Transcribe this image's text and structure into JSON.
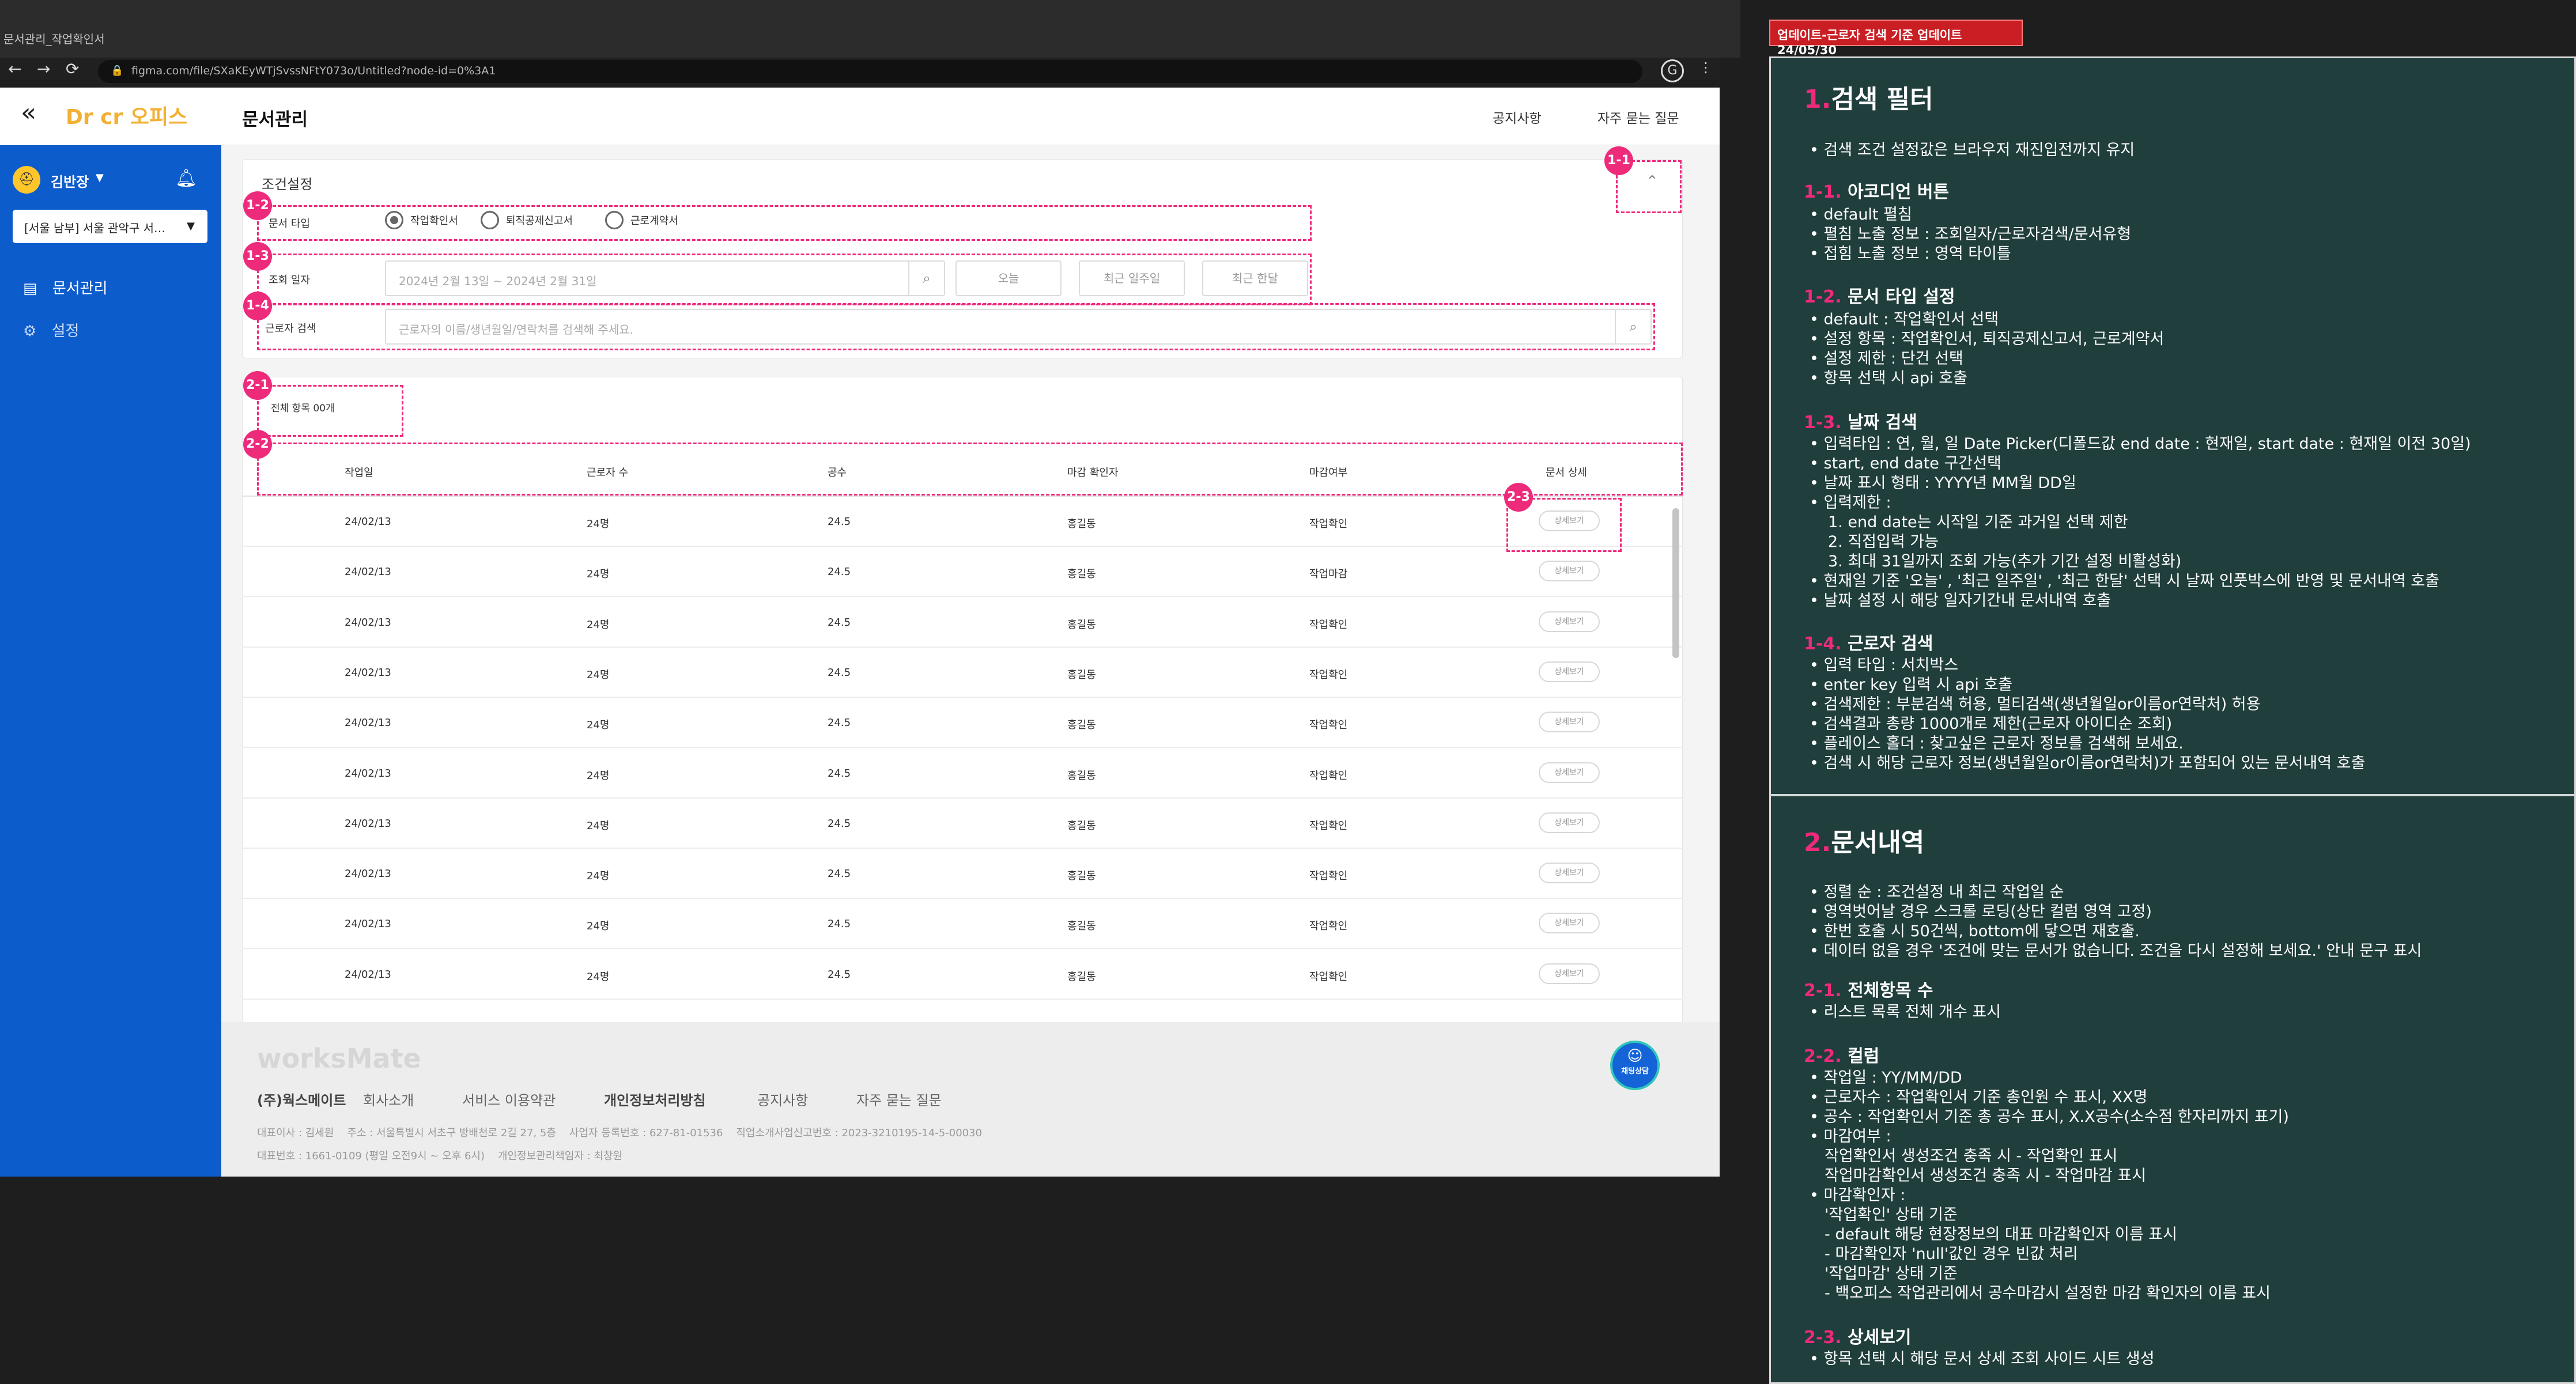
{
  "browser": {
    "tab_title": "문서관리_작업확인서",
    "url": "figma.com/file/SXaKEyWTjSvssNFtY073o/Untitled?node-id=0%3A1"
  },
  "app": {
    "logo": "Dr cr 오피스",
    "page_title": "문서관리",
    "header_links": [
      "공지사항",
      "자주 묻는 질문"
    ],
    "user": {
      "name": "김반장"
    },
    "site_select": "[서울 남부] 서울 관악구 서…",
    "nav": [
      {
        "label": "문서관리"
      },
      {
        "label": "설정"
      }
    ]
  },
  "filter": {
    "title": "조건설정",
    "doc_type_label": "문서 타입",
    "doc_types": [
      "작업확인서",
      "퇴직공제신고서",
      "근로계약서"
    ],
    "date_label": "조회 일자",
    "date_value": "2024년 2월 13일 ~ 2024년 2월 31일",
    "quick_buttons": [
      "오늘",
      "최근 일주일",
      "최근 한달"
    ],
    "worker_label": "근로자 검색",
    "worker_placeholder": "근로자의 이름/생년월일/연락처를 검색해 주세요."
  },
  "list": {
    "total": "전체 항목 00개",
    "columns": [
      "작업일",
      "근로자 수",
      "공수",
      "마감 확인자",
      "마감여부",
      "문서 상세"
    ],
    "detail_label": "상세보기",
    "rows": [
      [
        "24/02/13",
        "24명",
        "24.5",
        "홍길동",
        "작업확인"
      ],
      [
        "24/02/13",
        "24명",
        "24.5",
        "홍길동",
        "작업마감"
      ],
      [
        "24/02/13",
        "24명",
        "24.5",
        "홍길동",
        "작업확인"
      ],
      [
        "24/02/13",
        "24명",
        "24.5",
        "홍길동",
        "작업확인"
      ],
      [
        "24/02/13",
        "24명",
        "24.5",
        "홍길동",
        "작업확인"
      ],
      [
        "24/02/13",
        "24명",
        "24.5",
        "홍길동",
        "작업확인"
      ],
      [
        "24/02/13",
        "24명",
        "24.5",
        "홍길동",
        "작업확인"
      ],
      [
        "24/02/13",
        "24명",
        "24.5",
        "홍길동",
        "작업확인"
      ],
      [
        "24/02/13",
        "24명",
        "24.5",
        "홍길동",
        "작업확인"
      ],
      [
        "24/02/13",
        "24명",
        "24.5",
        "홍길동",
        "작업확인"
      ]
    ]
  },
  "footer": {
    "brand": "worksMate",
    "links": [
      "(주)웍스메이트",
      "회사소개",
      "서비스 이용약관",
      "개인정보처리방침",
      "공지사항",
      "자주 묻는 질문"
    ],
    "info1": "대표이사 : 김세원    주소 : 서울특별시 서초구 방배천로 2길 27, 5층    사업자 등록번호 : 627-81-01536    직업소개사업신고번호 : 2023-3210195-14-5-00030",
    "info2": "대표번호 : 1661-0109 (평일 오전9시 ~ 오후 6시)    개인정보관리책임자 : 최창원",
    "chat": "채팅상담"
  },
  "tags": [
    "1-1",
    "1-2",
    "1-3",
    "1-4",
    "2-1",
    "2-2",
    "2-3"
  ],
  "panel": {
    "update": "업데이트-근로자 검색 기준 업데이트 24/05/30",
    "s1": {
      "num": "1.",
      "title": "검색 필터",
      "note": "검색 조건 설정값은 브라우저 재진입전까지 유지"
    },
    "s11": {
      "num": "1-1.",
      "title": "아코디언 버튼",
      "lines": [
        "default 펼침",
        "펼침 노출 정보 : 조회일자/근로자검색/문서유형",
        "접힘 노출 정보 : 영역 타이틀"
      ]
    },
    "s12": {
      "num": "1-2.",
      "title": "문서 타입 설정",
      "lines": [
        "default : 작업확인서 선택",
        "설정 항목 : 작업확인서, 퇴직공제신고서, 근로계약서",
        "설정 제한 : 단건 선택",
        "항목 선택 시 api 호출"
      ]
    },
    "s13": {
      "num": "1-3.",
      "title": "날짜 검색",
      "lines": [
        "입력타입 : 연, 월, 일 Date Picker(디폴드값 end date : 현재일, start date : 현재일 이전 30일)",
        "start, end date 구간선택",
        "날짜 표시 형태 : YYYY년 MM월 DD일",
        "입력제한 :"
      ],
      "sub": [
        "1. end date는 시작일 기준 과거일 선택 제한",
        "2. 직접입력 가능",
        "3. 최대 31일까지 조회 가능(추가 기간 설정 비활성화)"
      ],
      "lines2": [
        "현재일 기준 '오늘' , '최근 일주일' , '최근 한달' 선택 시 날짜 인풋박스에 반영 및 문서내역 호출",
        "날짜 설정 시 해당 일자기간내 문서내역 호출"
      ]
    },
    "s14": {
      "num": "1-4.",
      "title": "근로자 검색",
      "lines": [
        "입력 타입 : 서치박스",
        "enter key 입력 시 api 호출",
        "검색제한 : 부분검색 허용, 멀티검색(생년월일or이름or연락처) 허용",
        "검색결과 총량 1000개로 제한(근로자 아이디순 조회)",
        "플레이스 홀더 : 찾고싶은 근로자 정보를 검색해 보세요.",
        "검색 시 해당 근로자 정보(생년월일or이름or연락처)가 포함되어 있는 문서내역 호출"
      ]
    },
    "s2": {
      "num": "2.",
      "title": "문서내역",
      "lines": [
        "정렬 순 : 조건설정 내 최근 작업일 순",
        "영역벗어날 경우 스크롤 로딩(상단 컬럼 영역 고정)",
        "한번 호출 시 50건씩, bottom에 닿으면 재호출.",
        "데이터 없을 경우 '조건에 맞는 문서가 없습니다. 조건을 다시 설정해 보세요.' 안내 문구 표시"
      ]
    },
    "s21": {
      "num": "2-1.",
      "title": "전체항목 수",
      "lines": [
        "리스트 목록 전체 개수 표시"
      ]
    },
    "s22": {
      "num": "2-2.",
      "title": "컬럼",
      "lines": [
        "작업일 : YY/MM/DD",
        "근로자수 : 작업확인서 기준 총인원 수 표시, XX명",
        "공수 : 작업확인서 기준 총 공수 표시, X.X공수(소수점 한자리까지 표기)",
        "마감여부 :"
      ],
      "sub1": [
        "작업확인서 생성조건 충족 시 - 작업확인 표시",
        "작업마감확인서 생성조건 충족 시 - 작업마감 표시"
      ],
      "line_closer": "마감확인자 :",
      "sub2": [
        "'작업확인' 상태 기준",
        "- default 해당 현장정보의 대표 마감확인자 이름 표시",
        "- 마감확인자 'null'값인 경우 빈값 처리",
        "'작업마감' 상태 기준",
        "- 백오피스 작업관리에서 공수마감시 설정한 마감 확인자의 이름 표시"
      ]
    },
    "s23": {
      "num": "2-3.",
      "title": "상세보기",
      "lines": [
        "항목 선택 시 해당 문서 상세 조회 사이드 시트 생성"
      ]
    }
  }
}
